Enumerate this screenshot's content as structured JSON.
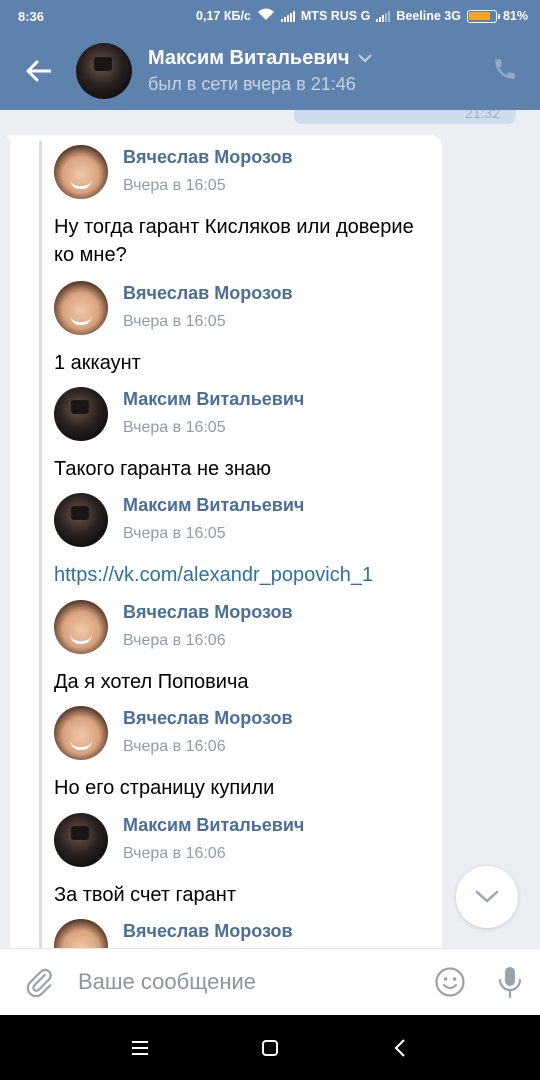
{
  "status_bar": {
    "time": "8:36",
    "speed": "0,17 КБ/с",
    "carrier1": "MTS RUS G",
    "carrier2": "Beeline 3G",
    "battery": "81%",
    "battery_level": 0.81,
    "icons": [
      "wifi-icon",
      "signal-icon",
      "signal-icon",
      "battery-icon"
    ]
  },
  "header": {
    "contact_name": "Максим Витальевич",
    "status": "был в сети вчера в 21:46",
    "background_color": "#5e82ae"
  },
  "previous_message_time": "21:32",
  "forwarded_messages": [
    {
      "author": "Вячеслав Морозов",
      "time": "Вчера в 16:05",
      "text": "Ну тогда гарант Кисляков или доверие ко мне?"
    },
    {
      "author": "Вячеслав Морозов",
      "time": "Вчера в 16:05",
      "text": "1 аккаунт"
    },
    {
      "author": "Максим Витальевич",
      "time": "Вчера в 16:05",
      "text": "Такого гаранта не знаю"
    },
    {
      "author": "Максим Витальевич",
      "time": "Вчера в 16:05",
      "text": "https://vk.com/alexandr_popovich_1"
    },
    {
      "author": "Вячеслав Морозов",
      "time": "Вчера в 16:06",
      "text": "Да я хотел Поповича"
    },
    {
      "author": "Вячеслав Морозов",
      "time": "Вчера в 16:06",
      "text": "Но его страницу купили"
    },
    {
      "author": "Максим Витальевич",
      "time": "Вчера в 16:06",
      "text": "За твой счет гарант"
    },
    {
      "author": "Вячеслав Морозов",
      "time": "",
      "text": ""
    }
  ],
  "composer": {
    "placeholder": "Ваше сообщение"
  },
  "colors": {
    "name_link": "#4a6f97",
    "url_link": "#2f6fa6",
    "chat_bg": "#ebeef2"
  }
}
